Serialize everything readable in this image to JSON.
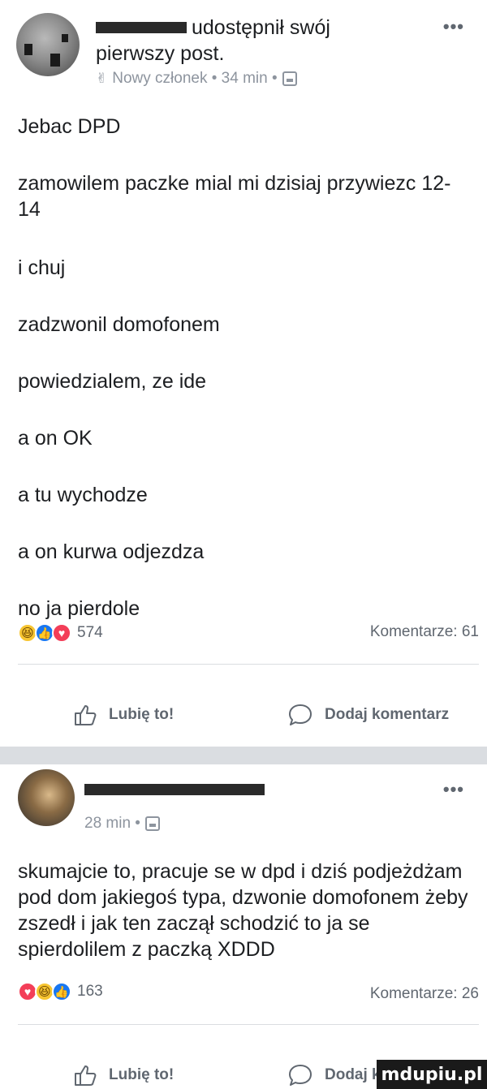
{
  "post1": {
    "author_suffix": "udostępnił swój",
    "author_line2": "pierwszy post.",
    "meta": "Nowy członek • 34 min •",
    "paragraphs": [
      "Jebac DPD",
      "zamowilem paczke mial mi dzisiaj przywiezc 12-14",
      "i chuj",
      "zadzwonil domofonem",
      "powiedzialem, ze ide",
      "a on OK",
      "a tu wychodze",
      "a on kurwa odjezdza",
      "no ja pierdole"
    ],
    "reaction_count": "574",
    "comments": "Komentarze: 61",
    "like_label": "Lubię to!",
    "comment_label": "Dodaj komentarz"
  },
  "post2": {
    "meta": "28 min •",
    "text": "skumajcie to, pracuje se w dpd i dziś podjeżdżam pod dom jakiegoś typa, dzwonie domofonem żeby zszedł i jak ten zaczął schodzić to ja se spierdolilem z paczką XDDD",
    "reaction_count": "163",
    "comments": "Komentarze: 26",
    "like_label": "Lubię to!",
    "comment_label": "Dodaj k"
  },
  "more_label": "•••",
  "watermark": "mdupiu.pl",
  "icons": {
    "member": "new-member-icon",
    "privacy": "group-privacy-icon",
    "like": "thumbs-up-icon",
    "comment": "comment-bubble-icon"
  }
}
